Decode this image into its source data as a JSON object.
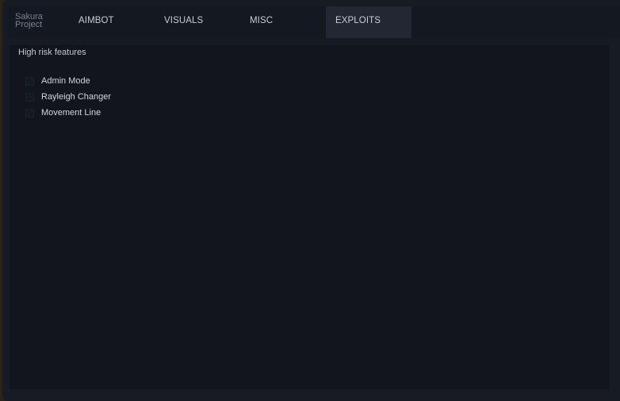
{
  "brand": {
    "line1": "Sakura",
    "line2": "Project"
  },
  "tabs": [
    {
      "label": "AIMBOT",
      "active": false
    },
    {
      "label": "VISUALS",
      "active": false
    },
    {
      "label": "MISC",
      "active": false
    },
    {
      "label": "EXPLOITS",
      "active": true
    }
  ],
  "section": {
    "title": "High risk features",
    "options": [
      {
        "label": "Admin Mode",
        "checked": false
      },
      {
        "label": "Rayleigh Changer",
        "checked": false
      },
      {
        "label": "Movement Line",
        "checked": false
      }
    ]
  },
  "colors": {
    "window_bg": "#171b23",
    "panel_bg": "#12151d",
    "active_tab": "#222733"
  }
}
